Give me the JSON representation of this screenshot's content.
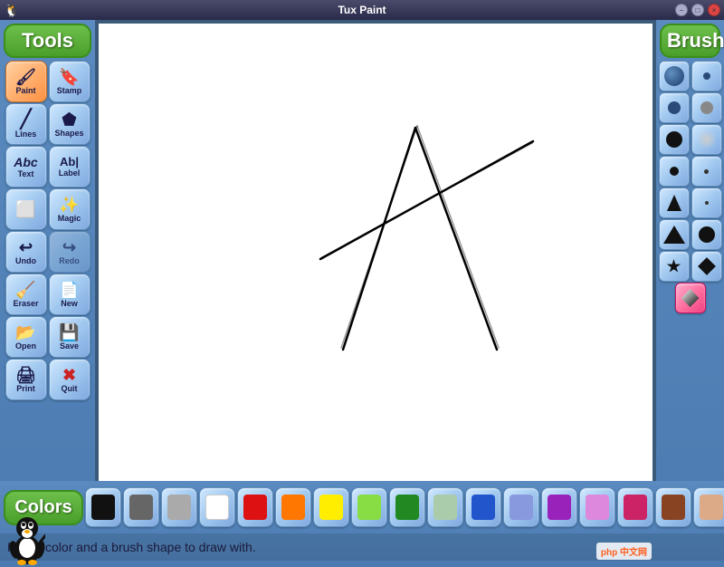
{
  "titlebar": {
    "title": "Tux Paint",
    "min_label": "−",
    "max_label": "□",
    "close_label": "×"
  },
  "tools": {
    "label": "Tools",
    "buttons": [
      {
        "id": "paint",
        "label": "Paint",
        "icon": "🖌"
      },
      {
        "id": "stamp",
        "label": "Stamp",
        "icon": "🔖"
      },
      {
        "id": "lines",
        "label": "Lines",
        "icon": "/"
      },
      {
        "id": "shapes",
        "label": "Shapes",
        "icon": "⬠"
      },
      {
        "id": "text",
        "label": "Text",
        "icon": "Abc"
      },
      {
        "id": "label",
        "label": "Label",
        "icon": "Ab|"
      },
      {
        "id": "magic",
        "label": "Magic",
        "icon": "✨"
      },
      {
        "id": "undo",
        "label": "Undo",
        "icon": "↩"
      },
      {
        "id": "redo",
        "label": "Redo",
        "icon": "↪"
      },
      {
        "id": "eraser",
        "label": "Eraser",
        "icon": "◻"
      },
      {
        "id": "new",
        "label": "New",
        "icon": "📄"
      },
      {
        "id": "open",
        "label": "Open",
        "icon": "📂"
      },
      {
        "id": "save",
        "label": "Save",
        "icon": "💾"
      },
      {
        "id": "print",
        "label": "Print",
        "icon": "🖨"
      },
      {
        "id": "quit",
        "label": "Quit",
        "icon": "✖"
      }
    ]
  },
  "brushes": {
    "label": "Brushes"
  },
  "colors": {
    "label": "Colors",
    "swatches": [
      "#111111",
      "#666666",
      "#aaaaaa",
      "#ffffff",
      "#dd1111",
      "#ff7700",
      "#ffee00",
      "#88dd44",
      "#228822",
      "#aaccaa",
      "#2255cc",
      "#8899dd",
      "#9922bb",
      "#dd88dd",
      "#cc2266",
      "#884422",
      "#ddaa88",
      "#ddddbb",
      "#111111"
    ]
  },
  "status": {
    "text": "Pick a color and a brush shape to draw with."
  }
}
